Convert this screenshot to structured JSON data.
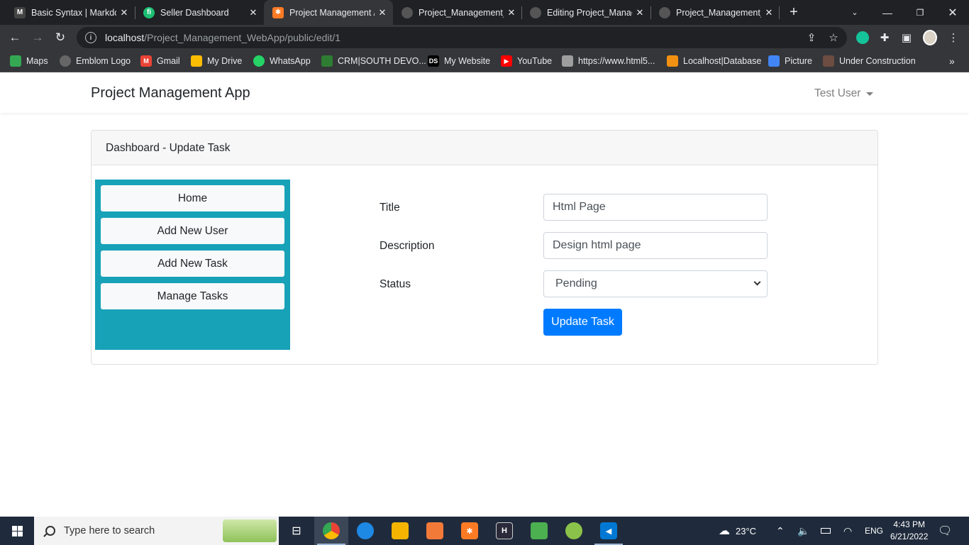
{
  "browser": {
    "tabs": [
      {
        "title": "Basic Syntax | Markdo",
        "icon": "markdown-icon",
        "color": "#444"
      },
      {
        "title": "Seller Dashboard",
        "icon": "fiverr-icon",
        "color": "#1dbf73"
      },
      {
        "title": "Project Management /",
        "icon": "xampp-icon",
        "color": "#fb7a24"
      },
      {
        "title": "Project_Management_",
        "icon": "github-icon",
        "color": "#555"
      },
      {
        "title": "Editing Project_Manag",
        "icon": "github-icon",
        "color": "#555"
      },
      {
        "title": "Project_Management_",
        "icon": "github-icon",
        "color": "#555"
      }
    ],
    "url_host": "localhost",
    "url_path": "/Project_Management_WebApp/public/edit/1",
    "bookmarks": [
      {
        "label": "Maps",
        "icon": "maps-icon",
        "color": "#34a853"
      },
      {
        "label": "Emblom Logo",
        "icon": "globe-icon",
        "color": "#666"
      },
      {
        "label": "Gmail",
        "icon": "gmail-icon",
        "color": "#ea4335"
      },
      {
        "label": "My Drive",
        "icon": "drive-icon",
        "color": "#fbbc04"
      },
      {
        "label": "WhatsApp",
        "icon": "whatsapp-icon",
        "color": "#25d366"
      },
      {
        "label": "CRM|SOUTH DEVO...",
        "icon": "crm-icon",
        "color": "#2e7d32"
      },
      {
        "label": "My Website",
        "icon": "ds-icon",
        "color": "#000"
      },
      {
        "label": "YouTube",
        "icon": "youtube-icon",
        "color": "#ff0000"
      },
      {
        "label": "https://www.html5...",
        "icon": "page-icon",
        "color": "#9e9e9e"
      },
      {
        "label": "Localhost|Database",
        "icon": "phpmyadmin-icon",
        "color": "#f29111"
      },
      {
        "label": "Picture",
        "icon": "picture-icon",
        "color": "#4285f4"
      },
      {
        "label": "Under Construction",
        "icon": "construction-icon",
        "color": "#6d4c41"
      }
    ]
  },
  "app": {
    "brand": "Project Management App",
    "user": "Test User",
    "card_title": "Dashboard - Update Task",
    "sidebar": [
      "Home",
      "Add New User",
      "Add New Task",
      "Manage Tasks"
    ],
    "form": {
      "title_label": "Title",
      "title_value": "Html Page",
      "description_label": "Description",
      "description_value": "Design html page",
      "status_label": "Status",
      "status_value": "Pending",
      "submit_label": "Update Task"
    }
  },
  "taskbar": {
    "search_placeholder": "Type here to search",
    "weather": "23°C",
    "language": "ENG",
    "time": "4:43 PM",
    "date": "6/21/2022"
  }
}
